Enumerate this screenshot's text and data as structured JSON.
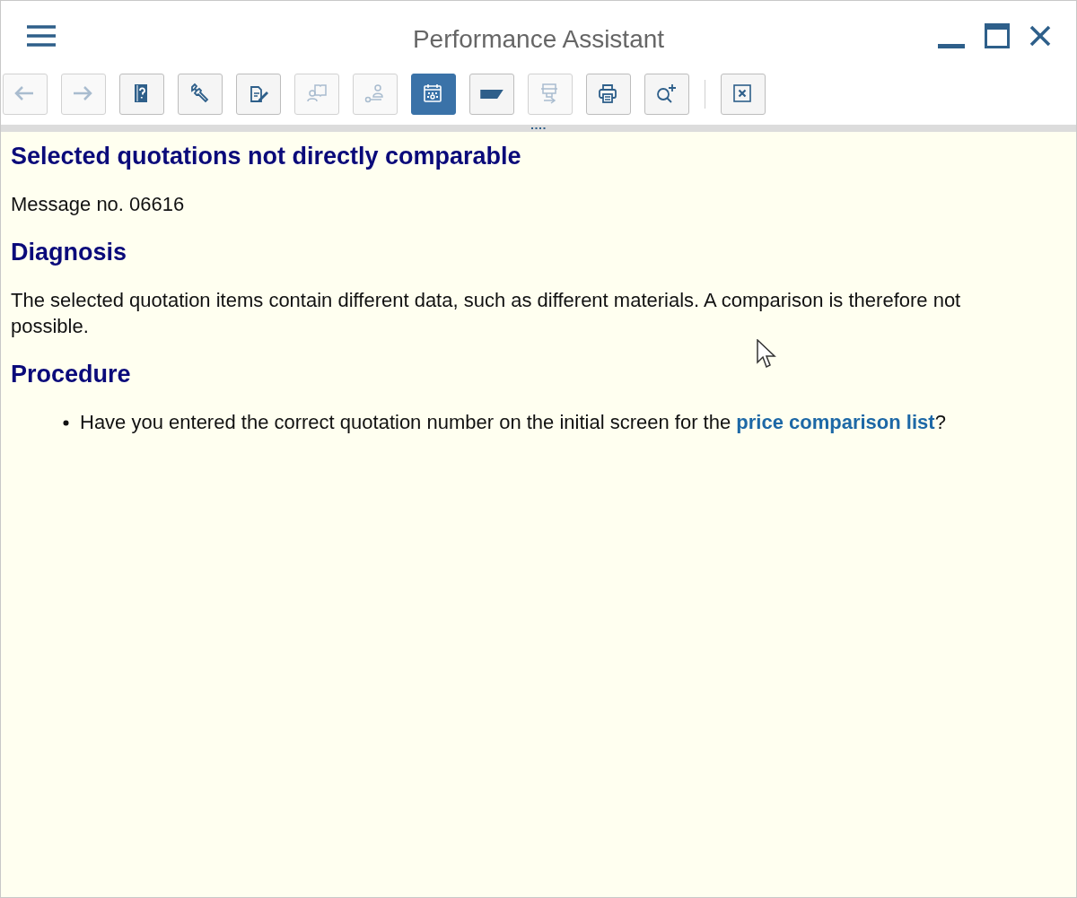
{
  "window": {
    "title": "Performance Assistant"
  },
  "toolbar": [
    {
      "kind": "back",
      "disabled": true,
      "selected": false
    },
    {
      "kind": "forward",
      "disabled": true,
      "selected": false
    },
    {
      "kind": "help-book",
      "disabled": false,
      "selected": false
    },
    {
      "kind": "wrench",
      "disabled": false,
      "selected": false
    },
    {
      "kind": "edit",
      "disabled": false,
      "selected": false
    },
    {
      "kind": "person-book",
      "disabled": true,
      "selected": false
    },
    {
      "kind": "person-key",
      "disabled": true,
      "selected": false
    },
    {
      "kind": "calendar",
      "disabled": false,
      "selected": true
    },
    {
      "kind": "tag",
      "disabled": false,
      "selected": false
    },
    {
      "kind": "transfer",
      "disabled": true,
      "selected": false
    },
    {
      "kind": "print",
      "disabled": false,
      "selected": false
    },
    {
      "kind": "zoom",
      "disabled": false,
      "selected": false
    },
    {
      "kind": "separator"
    },
    {
      "kind": "close-box",
      "disabled": false,
      "selected": false
    }
  ],
  "content": [
    {
      "kind": "heading",
      "text": "Selected quotations not directly comparable"
    },
    {
      "kind": "paragraph",
      "text": "Message no. 06616"
    },
    {
      "kind": "heading",
      "text": "Diagnosis"
    },
    {
      "kind": "paragraph",
      "text": "The selected quotation items contain different data, such as different materials. A comparison is therefore not possible."
    },
    {
      "kind": "heading",
      "text": "Procedure"
    },
    {
      "kind": "bullet",
      "text": "Have you entered the correct quotation number on the initial screen for the ",
      "link": "price comparison list",
      "after": "?"
    }
  ]
}
